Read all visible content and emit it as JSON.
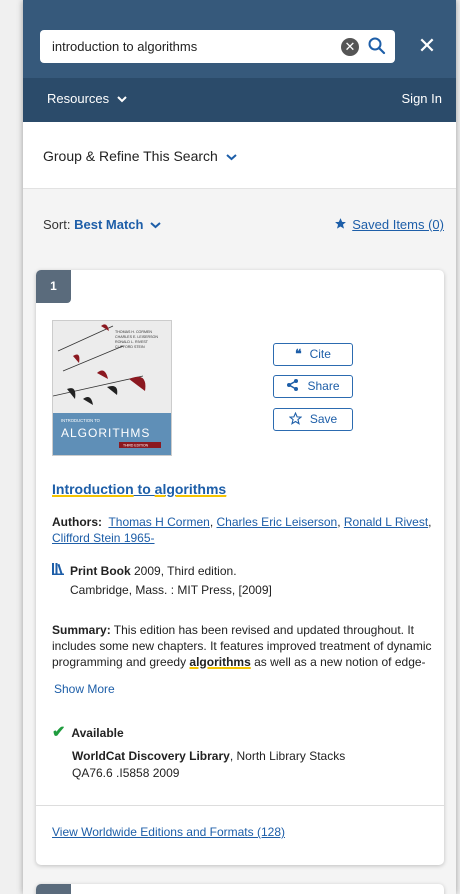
{
  "search": {
    "value": "introduction to algorithms",
    "clear_icon": "clear-icon",
    "search_icon": "search-icon",
    "close_label": "✕"
  },
  "nav": {
    "resources": "Resources",
    "sign_in": "Sign In"
  },
  "refine": {
    "label": "Group & Refine This Search"
  },
  "sort": {
    "label": "Sort:",
    "value": "Best Match",
    "saved_items": "Saved Items (0)"
  },
  "result": {
    "number": "1",
    "title_part1": "Introduction",
    "title_part2": " to ",
    "title_part3": "algorithms",
    "actions": {
      "cite": "Cite",
      "share": "Share",
      "save": "Save"
    },
    "cover": {
      "authors_text": [
        "THOMAS H. CORMEN",
        "CHARLES E. LEISERSON",
        "RONALD L. RIVEST",
        "CLIFFORD STEIN"
      ],
      "small_title": "INTRODUCTION TO",
      "big_title": "ALGORITHMS",
      "edition": "THIRD EDITION"
    },
    "authors_label": "Authors:",
    "authors": [
      "Thomas H Cormen",
      "Charles Eric Leiserson",
      "Ronald L Rivest",
      "Clifford Stein 1965-"
    ],
    "format_type": "Print Book",
    "format_detail": " 2009, Third edition.",
    "publisher": "Cambridge, Mass. : MIT Press, [2009]",
    "summary_label": "Summary:",
    "summary_text_1": "  This edition has been revised and updated throughout. It includes some new chapters. It features improved treatment of dynamic programming and greedy ",
    "summary_highlight": "algorithms",
    "summary_text_2": " as well as a new notion of edge-",
    "show_more": "Show More",
    "availability": "Available",
    "library_name": "WorldCat Discovery Library",
    "library_location": ", North Library Stacks",
    "call_number": "QA76.6 .I5858 2009",
    "editions_link": "View Worldwide Editions and Formats (128)"
  },
  "colors": {
    "header": "#36597b",
    "nav": "#2b4b6a",
    "link": "#1d5ea8",
    "badge": "#5a6b7c",
    "available": "#1f9c3e",
    "highlight": "#f5c400"
  }
}
